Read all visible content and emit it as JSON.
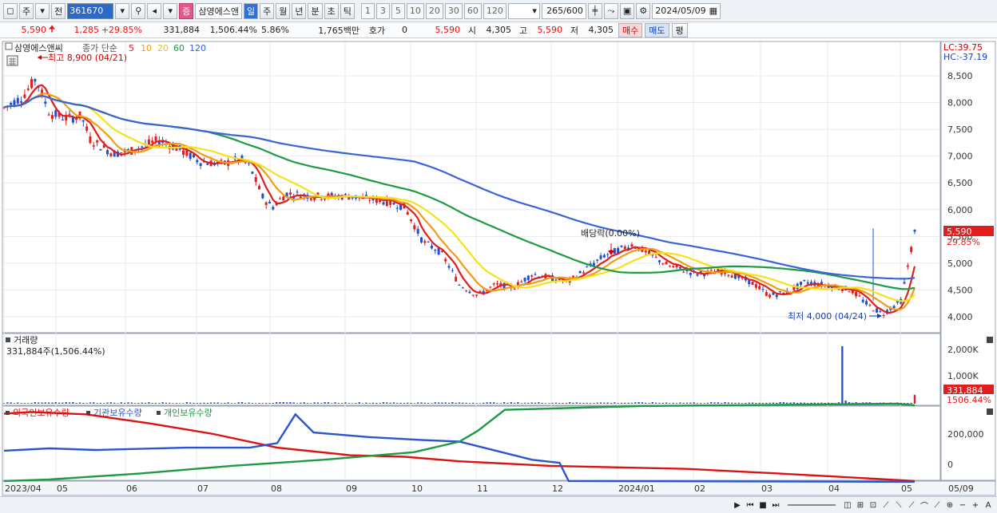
{
  "toolbar": {
    "market_label": "주",
    "all_label": "전",
    "code": "361670",
    "stock_tag": "증",
    "stock_name": "삼영에스앤",
    "period_buttons": [
      "일",
      "주",
      "월",
      "년",
      "분",
      "초",
      "틱"
    ],
    "period_selected": "일",
    "interval_buttons": [
      "1",
      "3",
      "5",
      "10",
      "20",
      "30",
      "60",
      "120"
    ],
    "count": "265",
    "count_total": "/600",
    "date": "2024/05/09"
  },
  "info": {
    "price": "5,590",
    "change": "1,285",
    "change_pct": "+29.85%",
    "volume": "331,884",
    "volume_pct": "1,506.44%",
    "turnover": "5.86%",
    "amount": "1,765백만",
    "quote_label": "호가",
    "quote_value": "0",
    "quote_price": "5,590",
    "open_label": "시",
    "open": "4,305",
    "high_label": "고",
    "high": "5,590",
    "low_label": "저",
    "low": "4,305",
    "buy_button": "매수",
    "sell_button": "매도",
    "eval_button": "평"
  },
  "price_panel": {
    "legend_name": "삼영에스앤씨",
    "legend_ma_title": "종가 단순",
    "ma_periods": [
      "5",
      "10",
      "20",
      "60",
      "120"
    ],
    "ma_colors": [
      "#e11d1d",
      "#f39c12",
      "#f5e21b",
      "#1e9a44",
      "#3a63d6"
    ],
    "high_note": "최고 8,900 (04/21)",
    "low_note": "최저 4,000 (04/24)",
    "dividend_note": "배당락(0.00%)",
    "lc": "LC:39.75",
    "hc": "HC:-37.19",
    "last_price_tag": "5,590",
    "last_pct_tag": "29.85%",
    "y_ticks": [
      "8,500",
      "8,000",
      "7,500",
      "7,000",
      "6,500",
      "6,000",
      "5,500",
      "5,000",
      "4,500",
      "4,000"
    ]
  },
  "volume_panel": {
    "title": "거래량",
    "value": "331,884주(1,506.44%)",
    "y_ticks": [
      "2,000K",
      "1,000K"
    ],
    "last_tag": "331,884",
    "last_pct": "1506.44%"
  },
  "holding_panel": {
    "legend": [
      "외국인보유수량",
      "기관보유수량",
      "개인보유수량"
    ],
    "colors": [
      "#d11",
      "#2a55d0",
      "#1e9a44"
    ],
    "y_ticks": [
      "200,000",
      "0"
    ]
  },
  "x_axis": {
    "labels": [
      "2023/04",
      "05",
      "06",
      "07",
      "08",
      "09",
      "10",
      "11",
      "12",
      "2024/01",
      "02",
      "03",
      "04",
      "05",
      "05/09"
    ]
  },
  "bottom": {
    "buttons": [
      "▶",
      "⏮",
      "■",
      "⏭",
      "−",
      "+",
      "A"
    ]
  }
}
